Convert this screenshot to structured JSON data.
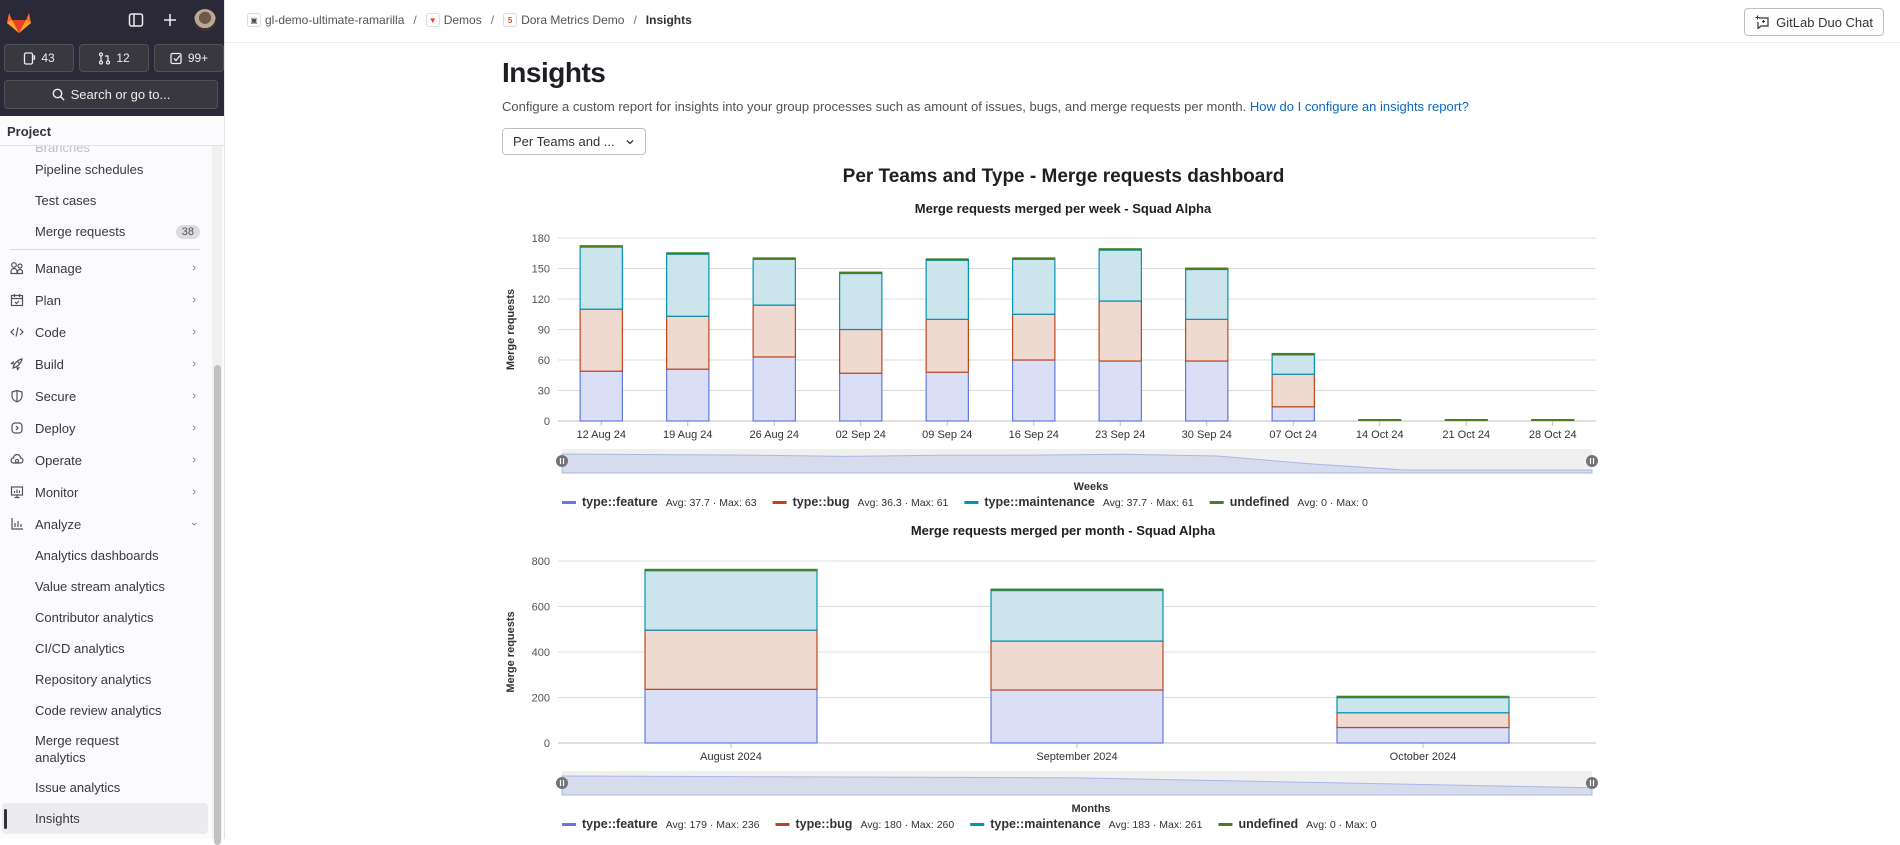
{
  "sidebar": {
    "counters": [
      {
        "icon": "issues-icon",
        "value": "43"
      },
      {
        "icon": "merge-request-icon",
        "value": "12"
      },
      {
        "icon": "todo-icon",
        "value": "99+"
      }
    ],
    "search_label": "Search or go to...",
    "section": "Project",
    "faded_item": "Branches",
    "items_top": [
      {
        "label": "Pipeline schedules"
      },
      {
        "label": "Test cases"
      },
      {
        "label": "Merge requests",
        "badge": "38"
      }
    ],
    "groups": [
      {
        "label": "Manage",
        "icon": "users-icon"
      },
      {
        "label": "Plan",
        "icon": "calendar-icon"
      },
      {
        "label": "Code",
        "icon": "code-icon"
      },
      {
        "label": "Build",
        "icon": "rocket-icon"
      },
      {
        "label": "Secure",
        "icon": "shield-icon"
      },
      {
        "label": "Deploy",
        "icon": "deploy-icon"
      },
      {
        "label": "Operate",
        "icon": "cloud-icon"
      },
      {
        "label": "Monitor",
        "icon": "monitor-icon"
      },
      {
        "label": "Analyze",
        "icon": "chart-icon",
        "expanded": true
      }
    ],
    "analyze_items": [
      {
        "label": "Analytics dashboards"
      },
      {
        "label": "Value stream analytics"
      },
      {
        "label": "Contributor analytics"
      },
      {
        "label": "CI/CD analytics"
      },
      {
        "label": "Repository analytics"
      },
      {
        "label": "Code review analytics"
      },
      {
        "label": "Merge request analytics"
      },
      {
        "label": "Issue analytics"
      },
      {
        "label": "Insights",
        "active": true
      }
    ]
  },
  "breadcrumb": [
    {
      "label": "gl-demo-ultimate-ramarilla"
    },
    {
      "label": "Demos"
    },
    {
      "label": "Dora Metrics Demo"
    },
    {
      "label": "Insights"
    }
  ],
  "duo_chat_label": "GitLab Duo Chat",
  "page": {
    "title": "Insights",
    "description": "Configure a custom report for insights into your group processes such as amount of issues, bugs, and merge requests per month.",
    "help_link": "How do I configure an insights report?",
    "dropdown_value": "Per Teams and ...",
    "dashboard_title": "Per Teams and Type - Merge requests dashboard"
  },
  "colors": {
    "feature": "#617ae2",
    "bug": "#c0451a",
    "maintenance": "#0094b6",
    "undefined": "#4b7d1f"
  },
  "chart_data": [
    {
      "type": "bar",
      "stacked": true,
      "title": "Merge requests merged per week - Squad Alpha",
      "xlabel": "Weeks",
      "ylabel": "Merge requests",
      "ylim": [
        0,
        180
      ],
      "yticks": [
        0,
        30,
        60,
        90,
        120,
        150,
        180
      ],
      "grid": true,
      "legend": "bottom",
      "categories": [
        "12 Aug 24",
        "19 Aug 24",
        "26 Aug 24",
        "02 Sep 24",
        "09 Sep 24",
        "16 Sep 24",
        "23 Sep 24",
        "30 Sep 24",
        "07 Oct 24",
        "14 Oct 24",
        "21 Oct 24",
        "28 Oct 24"
      ],
      "series": [
        {
          "name": "type::feature",
          "key": "feature",
          "stats": "Avg: 37.7 · Max: 63",
          "values": [
            49,
            51,
            63,
            47,
            48,
            60,
            59,
            59,
            14,
            0,
            0,
            0
          ]
        },
        {
          "name": "type::bug",
          "key": "bug",
          "stats": "Avg: 36.3 · Max: 61",
          "values": [
            61,
            52,
            51,
            43,
            52,
            45,
            59,
            41,
            32,
            0,
            0,
            0
          ]
        },
        {
          "name": "type::maintenance",
          "key": "maintenance",
          "stats": "Avg: 37.7 · Max: 61",
          "values": [
            61,
            61,
            45,
            55,
            58,
            54,
            50,
            49,
            19,
            0,
            0,
            0
          ]
        },
        {
          "name": "undefined",
          "key": "undefined",
          "stats": "Avg: 0 · Max: 0",
          "values": [
            0,
            0,
            0,
            0,
            0,
            0,
            0,
            0,
            0,
            0,
            0,
            0
          ]
        }
      ]
    },
    {
      "type": "bar",
      "stacked": true,
      "title": "Merge requests merged per month - Squad Alpha",
      "xlabel": "Months",
      "ylabel": "Merge requests",
      "ylim": [
        0,
        800
      ],
      "yticks": [
        0,
        200,
        400,
        600,
        800
      ],
      "grid": true,
      "legend": "bottom",
      "categories": [
        "August 2024",
        "September 2024",
        "October 2024"
      ],
      "series": [
        {
          "name": "type::feature",
          "key": "feature",
          "stats": "Avg: 179 · Max: 236",
          "values": [
            236,
            233,
            68
          ]
        },
        {
          "name": "type::bug",
          "key": "bug",
          "stats": "Avg: 180 · Max: 260",
          "values": [
            260,
            215,
            65
          ]
        },
        {
          "name": "type::maintenance",
          "key": "maintenance",
          "stats": "Avg: 183 · Max: 261",
          "values": [
            261,
            222,
            66
          ]
        },
        {
          "name": "undefined",
          "key": "undefined",
          "stats": "Avg: 0 · Max: 0",
          "values": [
            0,
            0,
            0
          ]
        }
      ]
    }
  ]
}
